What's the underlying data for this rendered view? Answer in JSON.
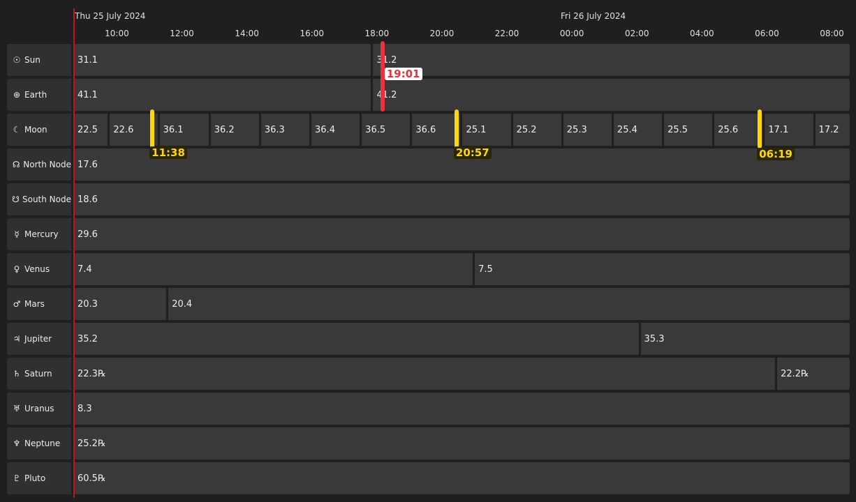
{
  "header": {
    "dates": [
      {
        "label": "Thu 25 July 2024"
      },
      {
        "label": "Fri 26 July 2024"
      }
    ],
    "hours": [
      "10:00",
      "12:00",
      "14:00",
      "16:00",
      "18:00",
      "20:00",
      "22:00",
      "00:00",
      "02:00",
      "04:00",
      "06:00",
      "08:00"
    ]
  },
  "timeline": {
    "start_hour": 8.68,
    "end_hour": 33.06
  },
  "rows": [
    {
      "name": "sun",
      "label": "Sun",
      "glyph": "☉",
      "cells": [
        {
          "text": "31.1",
          "end": 17.82
        },
        {
          "text": "31.2"
        }
      ]
    },
    {
      "name": "earth",
      "label": "Earth",
      "glyph": "⊕",
      "cells": [
        {
          "text": "41.1",
          "end": 17.82
        },
        {
          "text": "41.2"
        }
      ]
    },
    {
      "name": "moon",
      "label": "Moon",
      "glyph": "☾",
      "cells": [
        {
          "text": "22.5",
          "end": 9.72
        },
        {
          "text": "22.6",
          "end": 11.25
        },
        {
          "text": "36.1",
          "end": 12.82
        },
        {
          "text": "36.2",
          "end": 14.37
        },
        {
          "text": "36.3",
          "end": 15.92
        },
        {
          "text": "36.4",
          "end": 17.47
        },
        {
          "text": "36.5",
          "end": 19.02
        },
        {
          "text": "36.6",
          "end": 20.57
        },
        {
          "text": "25.1",
          "end": 22.12
        },
        {
          "text": "25.2",
          "end": 23.67
        },
        {
          "text": "25.3",
          "end": 25.22
        },
        {
          "text": "25.4",
          "end": 26.77
        },
        {
          "text": "25.5",
          "end": 28.32
        },
        {
          "text": "25.6",
          "end": 29.87
        },
        {
          "text": "17.1",
          "end": 31.42
        },
        {
          "text": "17.2"
        }
      ]
    },
    {
      "name": "north-node",
      "label": "North Node",
      "glyph": "☊",
      "cells": [
        {
          "text": "17.6"
        }
      ]
    },
    {
      "name": "south-node",
      "label": "South Node",
      "glyph": "☋",
      "cells": [
        {
          "text": "18.6"
        }
      ]
    },
    {
      "name": "mercury",
      "label": "Mercury",
      "glyph": "☿",
      "cells": [
        {
          "text": "29.6"
        }
      ]
    },
    {
      "name": "venus",
      "label": "Venus",
      "glyph": "♀",
      "cells": [
        {
          "text": "7.4",
          "end": 20.95
        },
        {
          "text": "7.5"
        }
      ]
    },
    {
      "name": "mars",
      "label": "Mars",
      "glyph": "♂",
      "cells": [
        {
          "text": "20.3",
          "end": 11.52
        },
        {
          "text": "20.4"
        }
      ]
    },
    {
      "name": "jupiter",
      "label": "Jupiter",
      "glyph": "♃",
      "cells": [
        {
          "text": "35.2",
          "end": 26.05
        },
        {
          "text": "35.3"
        }
      ]
    },
    {
      "name": "saturn",
      "label": "Saturn",
      "glyph": "♄",
      "cells": [
        {
          "text": "22.3℞",
          "end": 30.25
        },
        {
          "text": "22.2℞"
        }
      ]
    },
    {
      "name": "uranus",
      "label": "Uranus",
      "glyph": "♅",
      "cells": [
        {
          "text": "8.3"
        }
      ]
    },
    {
      "name": "neptune",
      "label": "Neptune",
      "glyph": "♆",
      "cells": [
        {
          "text": "25.2℞"
        }
      ]
    },
    {
      "name": "pluto",
      "label": "Pluto",
      "glyph": "♇",
      "cells": [
        {
          "text": "60.5℞"
        }
      ]
    }
  ],
  "now_marker": {
    "time": "19:01",
    "hour": 18.17,
    "color": "#e8323c"
  },
  "moon_markers": [
    {
      "time": "11:38",
      "hour": 11.09
    },
    {
      "time": "20:57",
      "hour": 20.45
    },
    {
      "time": "06:19",
      "hour": 29.78
    }
  ],
  "colors": {
    "marker_yellow": "#ffd60a",
    "now_line": "#c2141f",
    "cell": "#393939",
    "label_bg": "#303030"
  }
}
